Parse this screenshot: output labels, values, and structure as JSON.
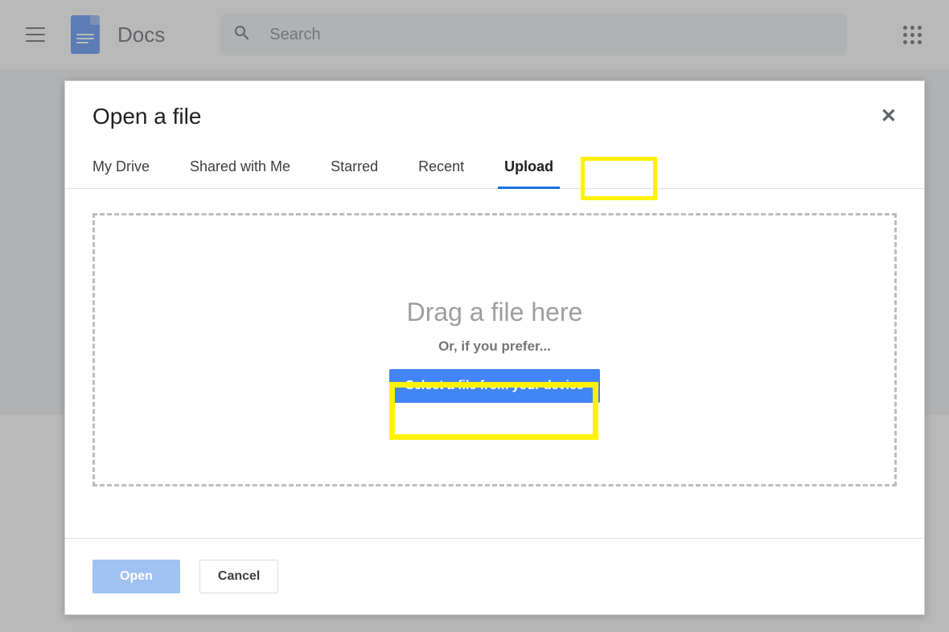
{
  "header": {
    "app_title": "Docs",
    "search_placeholder": "Search"
  },
  "dialog": {
    "title": "Open a file",
    "tabs": [
      {
        "label": "My Drive",
        "active": false
      },
      {
        "label": "Shared with Me",
        "active": false
      },
      {
        "label": "Starred",
        "active": false
      },
      {
        "label": "Recent",
        "active": false
      },
      {
        "label": "Upload",
        "active": true
      }
    ],
    "dropzone": {
      "title": "Drag a file here",
      "subtitle": "Or, if you prefer...",
      "button_label": "Select a file from your device"
    },
    "footer": {
      "open_label": "Open",
      "cancel_label": "Cancel"
    }
  }
}
